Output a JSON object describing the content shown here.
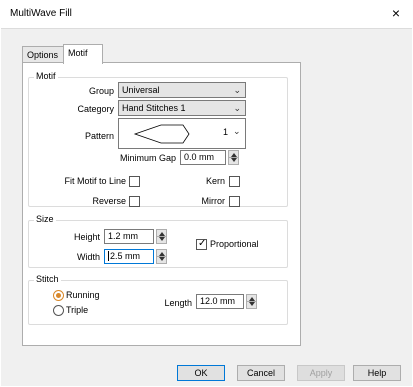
{
  "window": {
    "title": "MultiWave Fill",
    "close_glyph": "×"
  },
  "tabs": [
    {
      "label": "Options",
      "active": false
    },
    {
      "label": "Motif",
      "active": true
    }
  ],
  "motif": {
    "group_title": "Motif",
    "group_label": "Group",
    "group_value": "Universal",
    "category_label": "Category",
    "category_value": "Hand Stitches 1",
    "pattern_label": "Pattern",
    "pattern_index": "1",
    "min_gap_label": "Minimum Gap",
    "min_gap_value": "0.0 mm",
    "fit_label": "Fit Motif to Line",
    "fit_checked": false,
    "kern_label": "Kern",
    "kern_checked": false,
    "reverse_label": "Reverse",
    "reverse_checked": false,
    "mirror_label": "Mirror",
    "mirror_checked": false
  },
  "size": {
    "group_title": "Size",
    "height_label": "Height",
    "height_value": "1.2 mm",
    "width_label": "Width",
    "width_value": "2.5 mm",
    "proportional_label": "Proportional",
    "proportional_checked": true
  },
  "stitch": {
    "group_title": "Stitch",
    "running_label": "Running",
    "triple_label": "Triple",
    "selected": "Running",
    "length_label": "Length",
    "length_value": "12.0 mm"
  },
  "buttons": {
    "ok": "OK",
    "cancel": "Cancel",
    "apply": "Apply",
    "help": "Help"
  },
  "icons": {
    "dropdown": "chevron-down-icon",
    "spin": "spin-updown-icon",
    "close": "close-icon"
  }
}
